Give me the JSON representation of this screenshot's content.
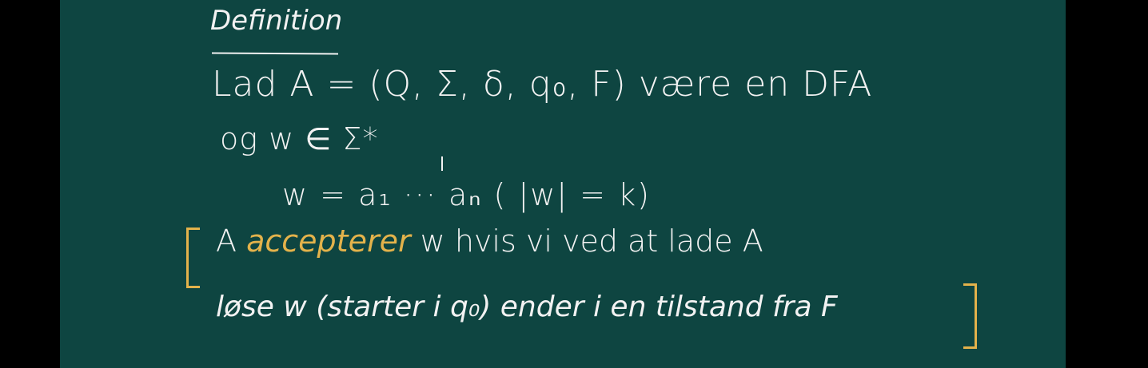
{
  "title": "Definition",
  "lines": {
    "line1": "Lad A = (Q, Σ, δ, q₀, F) være en DFA",
    "line2": "og w ∈ Σ*",
    "line3": "w = a₁ ··· aₙ   ( |w| = k)",
    "line4_prefix": "A",
    "line4_highlight": "accepterer",
    "line4_suffix": "w hvis vi ved at lade A",
    "line5": "løse w (starter i q₀) ender i en tilstand fra F"
  },
  "colors": {
    "board": "#0e4541",
    "chalk": "#f2f2f2",
    "highlight": "#e3b24b"
  }
}
